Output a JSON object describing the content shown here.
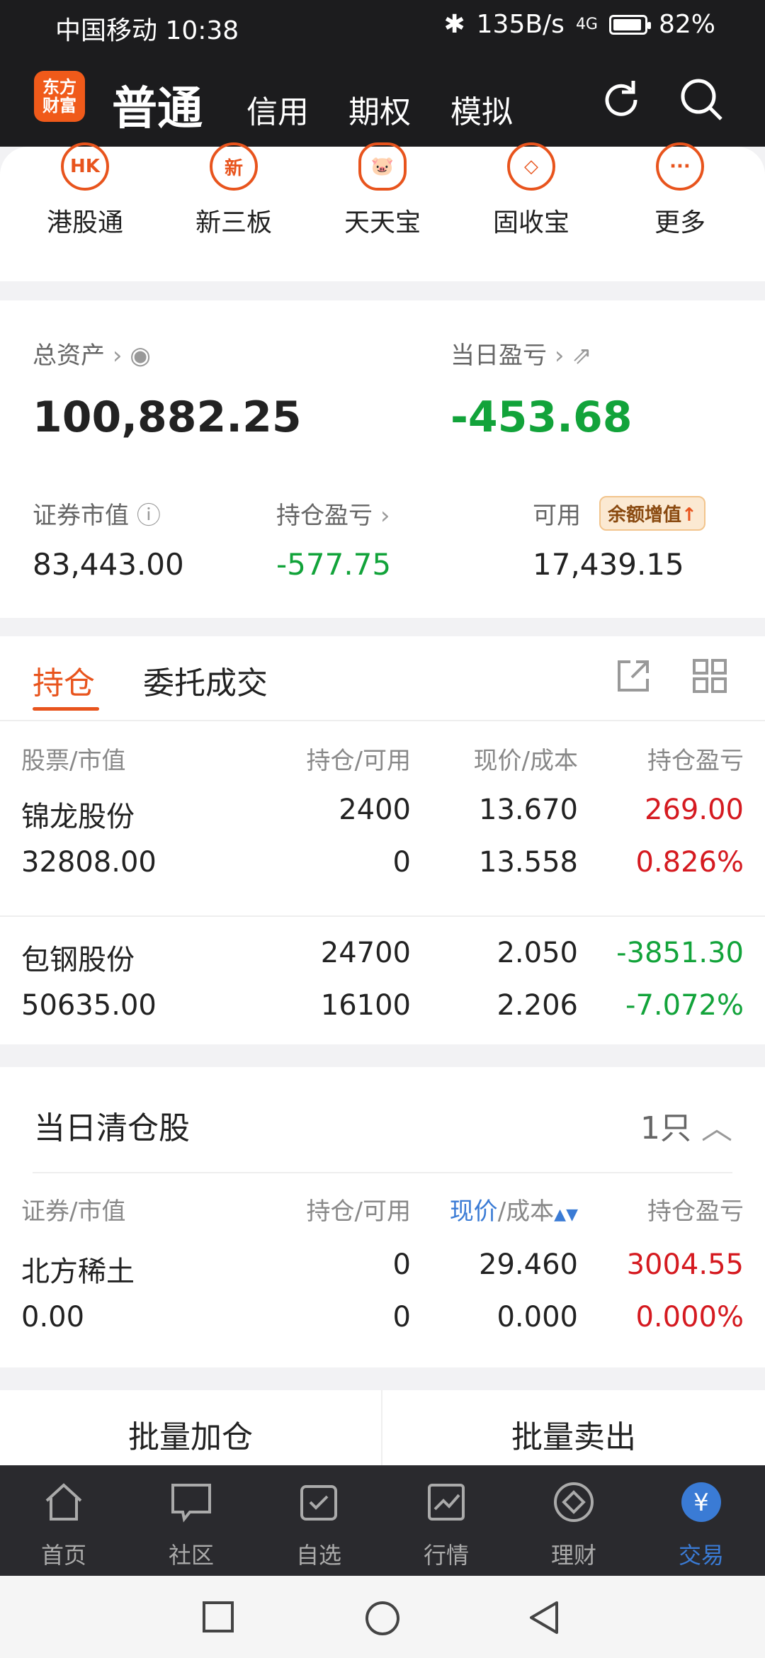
{
  "status_bar": {
    "carrier_time": "中国移动 10:38",
    "net_speed": "135B/s",
    "signal": "4G",
    "battery": "82%",
    "battery_level": 0.82
  },
  "header": {
    "logo_text": "东方财富",
    "tabs": [
      "普通",
      "信用",
      "期权",
      "模拟"
    ]
  },
  "quick_links": [
    "港股通",
    "新三板",
    "天天宝",
    "固收宝",
    "更多"
  ],
  "quick_icons": {
    "hk": "HK",
    "new": "新"
  },
  "assets": {
    "total_label": "总资产",
    "total_value": "100,882.25",
    "daily_pl_label": "当日盈亏",
    "daily_pl_value": "-453.68",
    "market_value_label": "证券市值",
    "market_value": "83,443.00",
    "position_pl_label": "持仓盈亏",
    "position_pl": "-577.75",
    "available_label": "可用",
    "available_value": "17,439.15",
    "badge": "余额增值"
  },
  "positions": {
    "tabs": [
      "持仓",
      "委托成交"
    ],
    "headers": [
      "股票/市值",
      "持仓/可用",
      "现价/成本",
      "持仓盈亏"
    ],
    "rows": [
      {
        "name": "锦龙股份",
        "market_value": "32808.00",
        "holding": "2400",
        "available": "0",
        "price": "13.670",
        "cost": "13.558",
        "pl": "269.00",
        "pl_pct": "0.826%"
      },
      {
        "name": "包钢股份",
        "market_value": "50635.00",
        "holding": "24700",
        "available": "16100",
        "price": "2.050",
        "cost": "2.206",
        "pl": "-3851.30",
        "pl_pct": "-7.072%"
      }
    ]
  },
  "cleared": {
    "title": "当日清仓股",
    "count": "1只",
    "headers": [
      "证券/市值",
      "持仓/可用",
      "现价",
      "/成本",
      "持仓盈亏"
    ],
    "rows": [
      {
        "name": "北方稀土",
        "market_value": "0.00",
        "holding": "0",
        "available": "0",
        "price": "29.460",
        "cost": "0.000",
        "pl": "3004.55",
        "pl_pct": "0.000%"
      }
    ]
  },
  "batch": {
    "add": "批量加仓",
    "sell": "批量卖出"
  },
  "bottom_nav": [
    "首页",
    "社区",
    "自选",
    "行情",
    "理财",
    "交易"
  ],
  "colors": {
    "accent": "#e8541d",
    "up": "#d51a20",
    "down": "#12a33a",
    "active_nav": "#3a7bd5"
  }
}
